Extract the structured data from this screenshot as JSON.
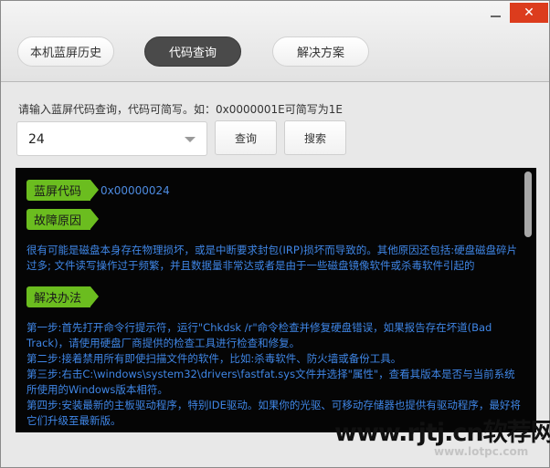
{
  "window": {
    "minimize_icon": "minimize-icon",
    "close_icon": "close-icon",
    "close_glyph": "✕"
  },
  "tabs": [
    {
      "label": "本机蓝屏历史",
      "active": false
    },
    {
      "label": "代码查询",
      "active": true
    },
    {
      "label": "解决方案",
      "active": false
    }
  ],
  "query": {
    "hint": "请输入蓝屏代码查询，代码可简写。如：0x0000001E可简写为1E",
    "input_value": "24",
    "dropdown_icon": "chevron-down-icon",
    "query_button": "查询",
    "search_button": "搜索"
  },
  "result": {
    "code_tag": "蓝屏代码",
    "code_value": "0x00000024",
    "cause_tag": "故障原因",
    "cause_text": "很有可能是磁盘本身存在物理损坏，或是中断要求封包(IRP)损坏而导致的。其他原因还包括:硬盘磁盘碎片过多; 文件读写操作过于频繁，并且数据量非常达或者是由于一些磁盘镜像软件或杀毒软件引起的",
    "solution_tag": "解决办法",
    "solution_steps": [
      "第一步:首先打开命令行提示符，运行\"Chkdsk /r\"命令检查并修复硬盘错误，如果报告存在坏道(Bad Track)，请使用硬盘厂商提供的检查工具进行检查和修复。",
      "第二步:接着禁用所有即使扫描文件的软件，比如:杀毒软件、防火墙或备份工具。",
      "第三步:右击C:\\windows\\system32\\drivers\\fastfat.sys文件并选择\"属性\"，查看其版本是否与当前系统所使用的Windows版本相符。",
      "第四步:安装最新的主板驱动程序，特别IDE驱动。如果你的光驱、可移动存储器也提供有驱动程序，最好将它们升级至最新版。"
    ]
  },
  "colors": {
    "tag_green": "#6bbd1f",
    "text_blue": "#3f86e6",
    "panel_bg": "#050505",
    "close_red": "#dc3c1d",
    "active_tab": "#4a4a4a"
  },
  "watermark": {
    "primary": "www.rjtj.cn软荐网",
    "secondary": "www.lotpc.com"
  }
}
